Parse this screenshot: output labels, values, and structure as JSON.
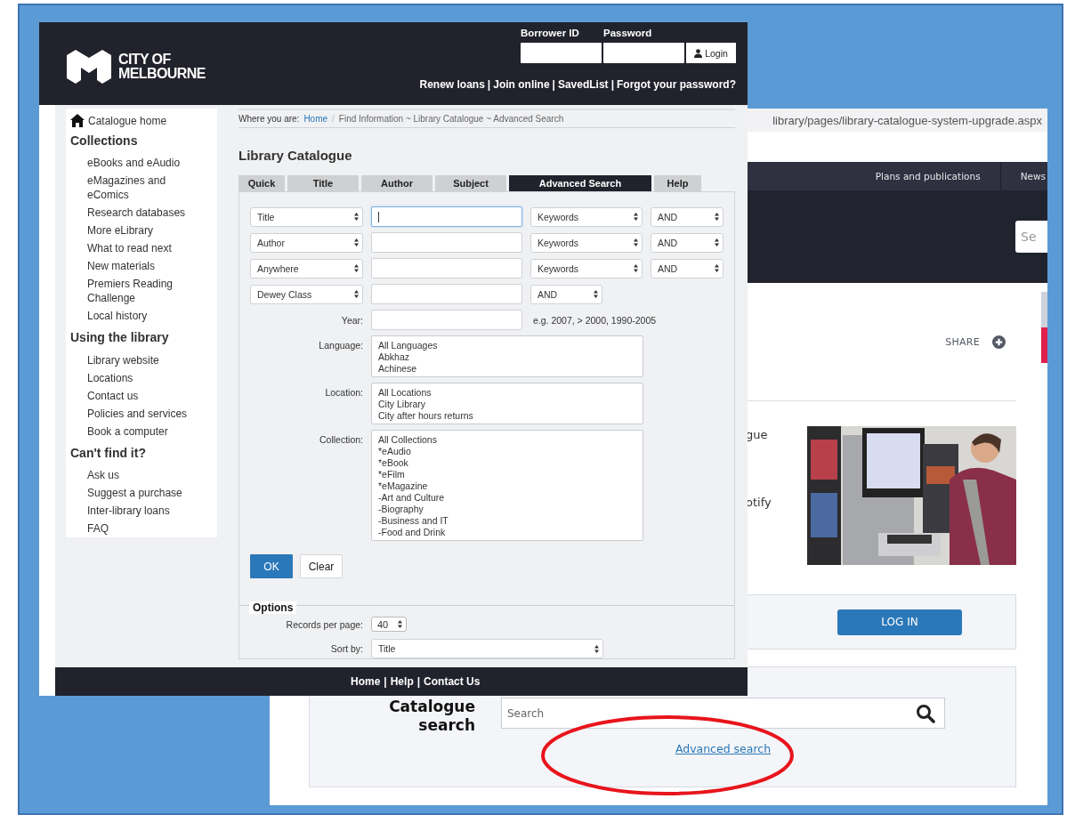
{
  "background_window": {
    "url": "library/pages/library-catalogue-system-upgrade.aspx",
    "nav": [
      "Plans and publications",
      "News"
    ],
    "site_search_placeholder": "Se",
    "share": "SHARE",
    "text_fragments": [
      "gue",
      "otify"
    ],
    "picture": {
      "kind": "picture"
    },
    "login_button": "LOG IN",
    "catalogue_search": {
      "title": "Catalogue search",
      "placeholder": "Search",
      "link": "Advanced search"
    }
  },
  "annotation": {
    "kind": "ellipse"
  },
  "front_window": {
    "logo": [
      "CITY OF",
      "MELBOURNE"
    ],
    "login": {
      "fields": [
        {
          "label": "Borrower ID"
        },
        {
          "label": "Password"
        }
      ],
      "button": "Login"
    },
    "header_links": [
      "Renew loans",
      "Join online",
      "SavedList",
      "Forgot your password?"
    ],
    "link_separator": "|",
    "sidebar": {
      "home": "Catalogue home",
      "sections": [
        {
          "title": "Collections",
          "items": [
            "eBooks and eAudio",
            "eMagazines and eComics",
            "Research databases",
            "More eLibrary",
            "What to read next",
            "New materials",
            "Premiers Reading Challenge",
            "Local history"
          ]
        },
        {
          "title": "Using the library",
          "items": [
            "Library website",
            "Locations",
            "Contact us",
            "Policies and services",
            "Book a computer"
          ]
        },
        {
          "title": "Can't find it?",
          "items": [
            "Ask us",
            "Suggest a purchase",
            "Inter-library loans",
            "FAQ"
          ]
        }
      ]
    },
    "breadcrumb": {
      "label": "Where you are:",
      "home": "Home",
      "separator": "/",
      "path": "Find Information ~ Library Catalogue ~ Advanced Search"
    },
    "title": "Library Catalogue",
    "tabs": [
      {
        "label": "Quick",
        "selected": false
      },
      {
        "label": "Title",
        "selected": false
      },
      {
        "label": "Author",
        "selected": false
      },
      {
        "label": "Subject",
        "selected": false
      },
      {
        "label": "Advanced Search",
        "selected": true
      },
      {
        "label": "Help",
        "selected": false
      }
    ],
    "search_rows": [
      {
        "field": "Title",
        "match": "Keywords",
        "operator": "AND",
        "focused": true
      },
      {
        "field": "Author",
        "match": "Keywords",
        "operator": "AND",
        "focused": false
      },
      {
        "field": "Anywhere",
        "match": "Keywords",
        "operator": "AND",
        "focused": false
      },
      {
        "field": "Dewey Class",
        "operator": "AND",
        "focused": false
      }
    ],
    "year": {
      "label": "Year:",
      "hint": "e.g. 2007, > 2000, 1990-2005"
    },
    "lists": [
      {
        "label": "Language:",
        "options": [
          "All Languages",
          "Abkhaz",
          "Achinese"
        ]
      },
      {
        "label": "Location:",
        "options": [
          "All Locations",
          "City Library",
          "City after hours returns"
        ]
      },
      {
        "label": "Collection:",
        "options": [
          "All Collections",
          "*eAudio",
          "*eBook",
          "*eFilm",
          "*eMagazine",
          "-Art and Culture",
          "-Biography",
          "-Business and IT",
          "-Food and Drink"
        ]
      }
    ],
    "buttons": [
      {
        "label": "OK",
        "kind": "primary"
      },
      {
        "label": "Clear",
        "kind": "secondary"
      }
    ],
    "options": {
      "legend": "Options",
      "records_per_page": {
        "label": "Records per page:",
        "value": "40"
      },
      "sort_by": {
        "label": "Sort by:",
        "value": "Title"
      }
    },
    "footer_links": [
      "Home",
      "Help",
      "Contact Us"
    ]
  }
}
